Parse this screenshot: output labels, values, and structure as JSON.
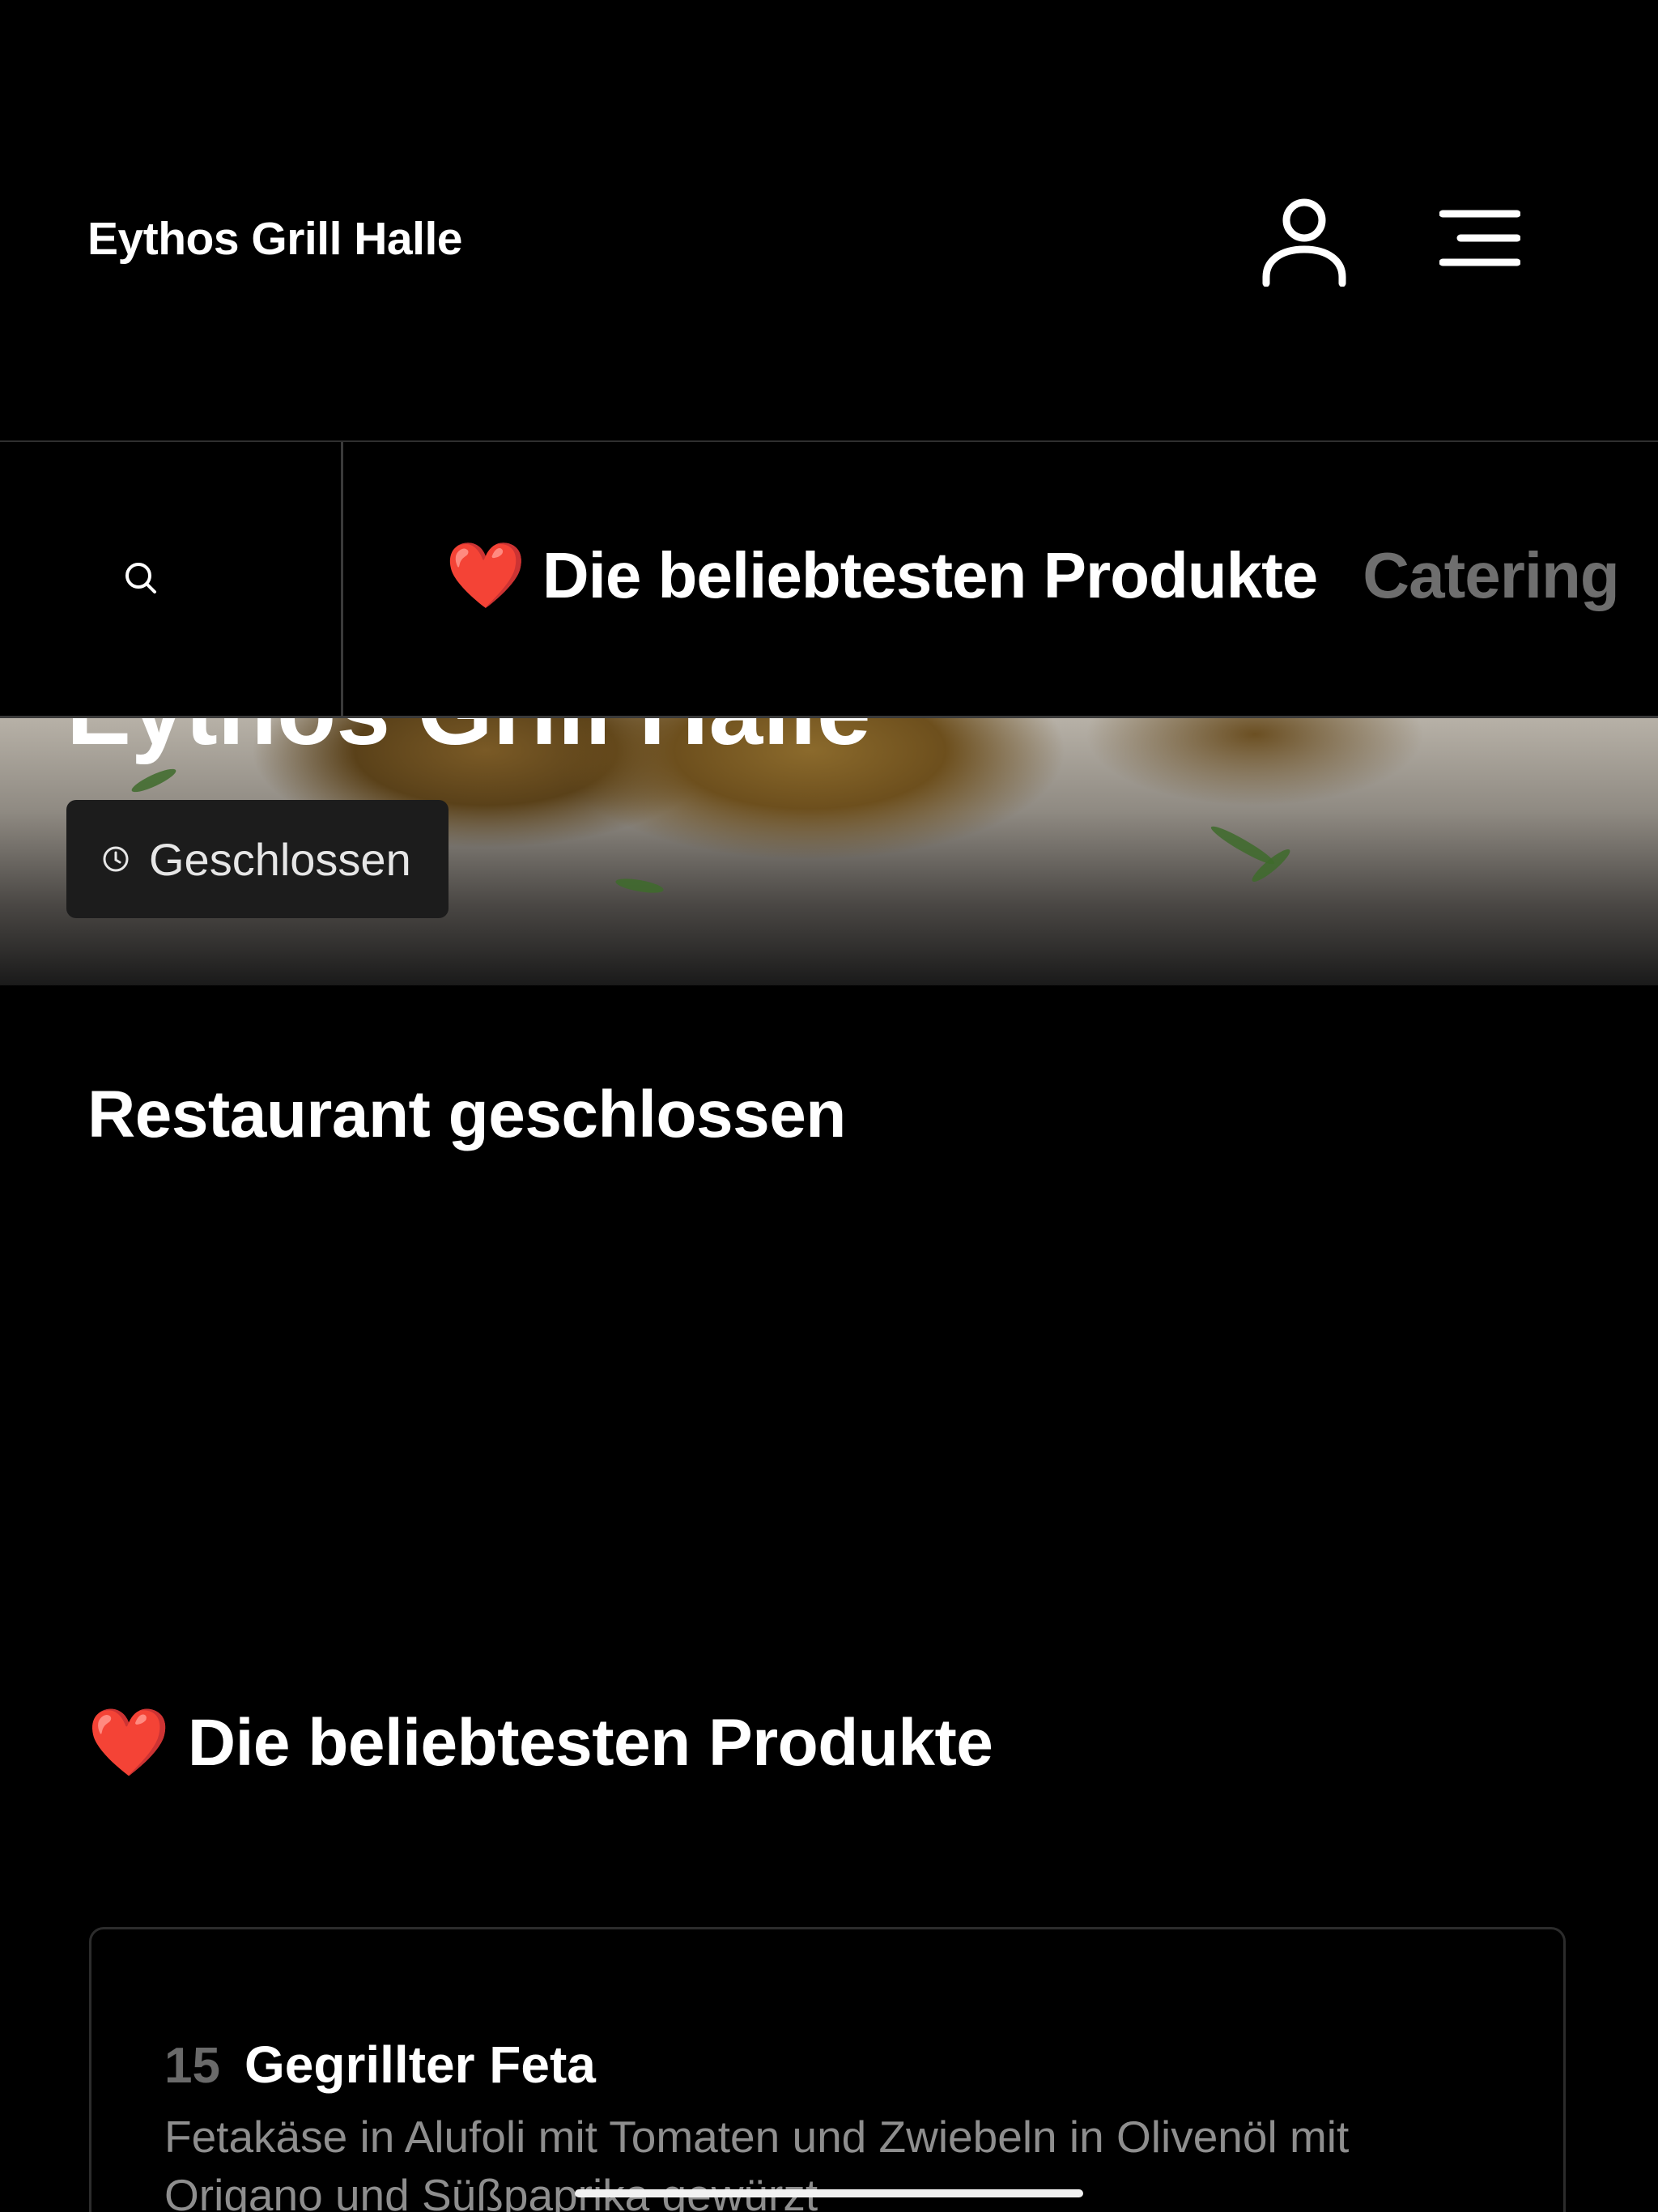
{
  "app": {
    "title": "Eythos Grill Halle"
  },
  "header": {
    "account_icon": "user-icon",
    "menu_icon": "hamburger-menu-icon"
  },
  "category_nav": {
    "search_icon": "search-icon",
    "items": [
      {
        "label": "❤️ Die beliebtesten Produkte",
        "active": true
      },
      {
        "label": "Catering",
        "active": false
      }
    ]
  },
  "hero": {
    "restaurant_name": "Eythos Grill Halle",
    "status_label": "Geschlossen",
    "status_icon": "clock-icon"
  },
  "main": {
    "closed_heading": "Restaurant geschlossen",
    "section_heading": "❤️ Die beliebtesten Produkte",
    "products": [
      {
        "number": "15",
        "name": "Gegrillter Feta",
        "description": "Fetakäse in Alufoli mit Tomaten und Zwiebeln in Olivenöl mit Origano und Süßpaprika gewürzt"
      }
    ]
  },
  "colors": {
    "background": "#000000",
    "text_primary": "#ffffff",
    "text_muted": "#8e8e8e",
    "inactive_tab": "#6e6e6e",
    "record_indicator": "#ff3b30"
  }
}
